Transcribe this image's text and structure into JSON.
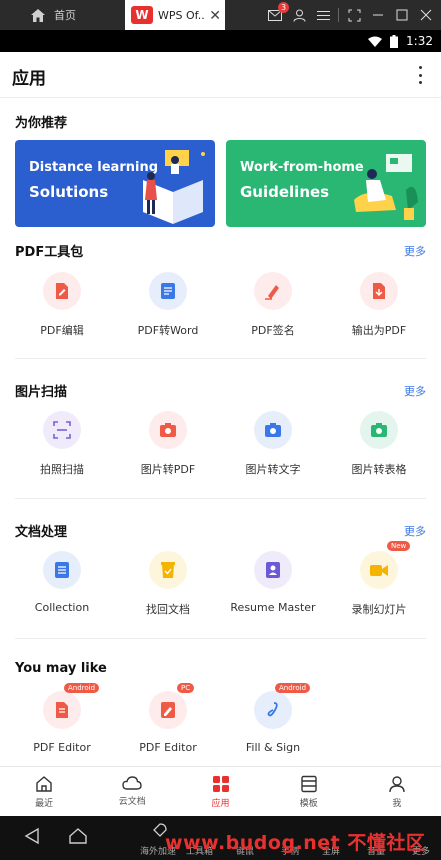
{
  "emulator": {
    "home_tab_label": "首页",
    "app_tab_title": "WPS Of..",
    "app_tab_logo": "W",
    "mail_badge": "3",
    "toolbar_labels": [
      "海外加速",
      "工具箱",
      "键鼠",
      "手柄",
      "全屏",
      "音量",
      "更多"
    ],
    "watermark": "www.budog.net 不懂社区"
  },
  "status_bar": {
    "time": "1:32"
  },
  "header": {
    "title": "应用"
  },
  "recommend": {
    "title": "为你推荐",
    "banners": [
      {
        "line1": "Distance learning",
        "line2": "Solutions",
        "color": "#2b5fd0"
      },
      {
        "line1": "Work-from-home",
        "line2": "Guidelines",
        "color": "#2ab673"
      }
    ]
  },
  "sections": [
    {
      "title": "PDF工具包",
      "more": "更多",
      "items": [
        {
          "label": "PDF编辑",
          "icon": "pdf-edit-icon",
          "tone": "red"
        },
        {
          "label": "PDF转Word",
          "icon": "pdf-to-word-icon",
          "tone": "blue"
        },
        {
          "label": "PDF签名",
          "icon": "pdf-sign-icon",
          "tone": "red"
        },
        {
          "label": "输出为PDF",
          "icon": "export-pdf-icon",
          "tone": "red"
        }
      ]
    },
    {
      "title": "图片扫描",
      "more": "更多",
      "items": [
        {
          "label": "拍照扫描",
          "icon": "scan-icon",
          "tone": "purple"
        },
        {
          "label": "图片转PDF",
          "icon": "image-to-pdf-icon",
          "tone": "red"
        },
        {
          "label": "图片转文字",
          "icon": "image-to-text-icon",
          "tone": "blue"
        },
        {
          "label": "图片转表格",
          "icon": "image-to-sheet-icon",
          "tone": "green"
        }
      ]
    },
    {
      "title": "文档处理",
      "more": "更多",
      "items": [
        {
          "label": "Collection",
          "icon": "collection-icon",
          "tone": "blue"
        },
        {
          "label": "找回文档",
          "icon": "recover-doc-icon",
          "tone": "yellow"
        },
        {
          "label": "Resume Master",
          "icon": "resume-icon",
          "tone": "purple"
        },
        {
          "label": "录制幻灯片",
          "icon": "record-slides-icon",
          "tone": "yellow",
          "badge": "New"
        }
      ]
    },
    {
      "title": "You may like",
      "items": [
        {
          "label": "PDF Editor",
          "icon": "pdf-editor-android-icon",
          "tone": "red",
          "badge": "Android"
        },
        {
          "label": "PDF Editor",
          "icon": "pdf-editor-pc-icon",
          "tone": "red",
          "badge": "PC"
        },
        {
          "label": "Fill & Sign",
          "icon": "fill-sign-icon",
          "tone": "blue",
          "badge": "Android"
        }
      ]
    }
  ],
  "bottom_nav": [
    {
      "label": "最近",
      "icon": "home-icon",
      "active": false
    },
    {
      "label": "云文档",
      "icon": "cloud-icon",
      "active": false
    },
    {
      "label": "应用",
      "icon": "apps-icon",
      "active": true
    },
    {
      "label": "模板",
      "icon": "template-icon",
      "active": false
    },
    {
      "label": "我",
      "icon": "profile-icon",
      "active": false
    }
  ],
  "colors": {
    "accent": "#e8312f",
    "link": "#3b78e7"
  }
}
